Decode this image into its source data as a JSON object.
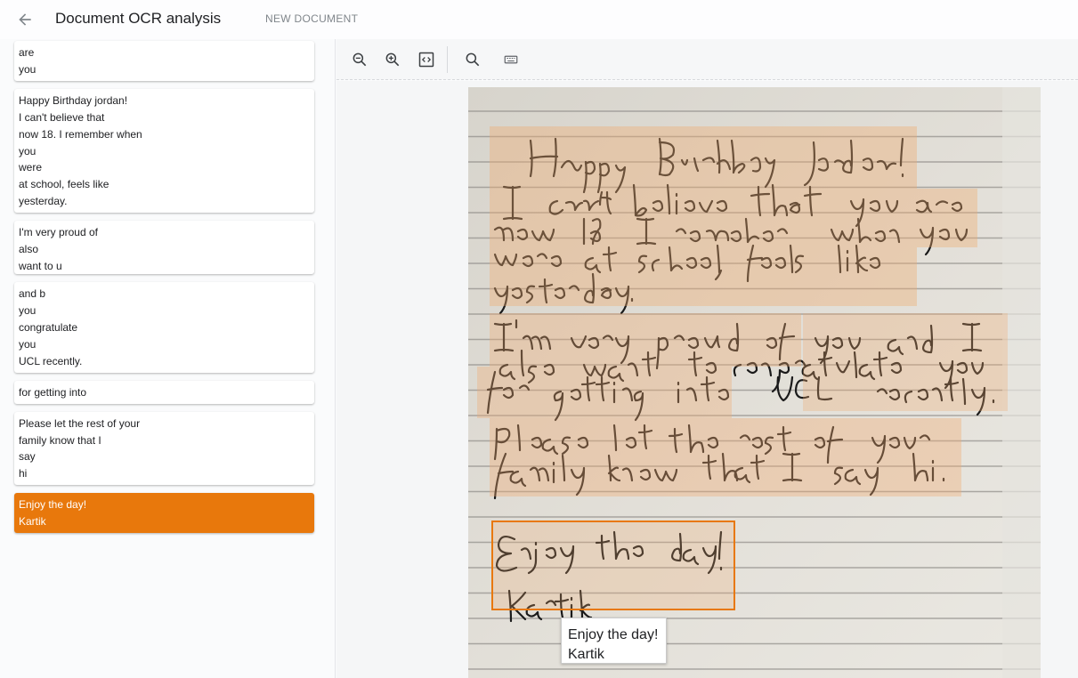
{
  "header": {
    "title": "Document OCR analysis",
    "new_document": "NEW DOCUMENT"
  },
  "blocks": [
    {
      "lines": [
        "are",
        "you"
      ]
    },
    {
      "lines": [
        "Happy Birthday jordan!",
        "I can't believe that",
        "now 18. I remember when",
        "you",
        "were",
        "at school, feels like",
        "yesterday."
      ]
    },
    {
      "lines": [
        "I'm very proud of",
        "also",
        "want to u"
      ]
    },
    {
      "lines": [
        "and b",
        "you",
        "congratulate",
        "you",
        "UCL recently."
      ]
    },
    {
      "lines": [
        "for getting into"
      ]
    },
    {
      "lines": [
        "Please let the rest of your",
        "family know that I",
        "say",
        "hi"
      ]
    },
    {
      "lines": [
        "Enjoy the day!",
        "Kartik"
      ]
    }
  ],
  "toolbar": {
    "icons": [
      "zoom-out-icon",
      "zoom-in-icon",
      "code-icon",
      "search-icon",
      "keyboard-icon"
    ]
  },
  "tooltip": {
    "lines": [
      "Enjoy the day!",
      "Kartik"
    ]
  },
  "colors": {
    "accent": "#e8780c",
    "highlight": "#f0aa6e"
  }
}
